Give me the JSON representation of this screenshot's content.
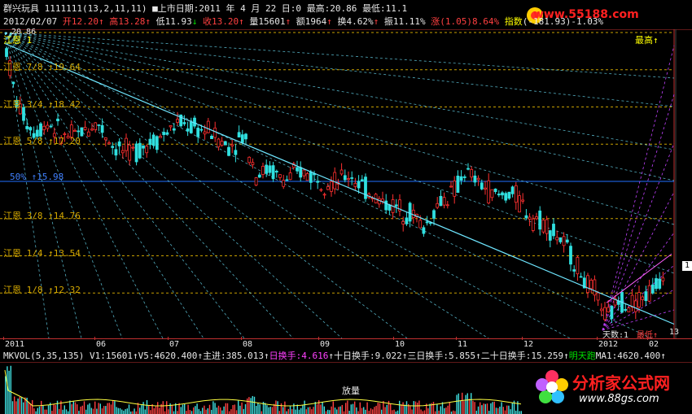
{
  "window": {
    "title": "群兴玩具",
    "code_params": "1111111(13,2,11,11)",
    "listing_label": "上市日期:2011 年 4 月 22 日:0",
    "high_label": "最高:20.86",
    "low_label": "最低:11.1"
  },
  "quote_line": {
    "date": "2012/02/07",
    "open": "开12.20",
    "high": "高13.28",
    "low": "低11.93",
    "close": "收13.20",
    "volume": "量15601",
    "amount": "额1964",
    "turnover": "换4.62%",
    "amplitude": "振11.11%",
    "change_label": "涨",
    "change": "(1.05)8.64%",
    "index_label": "指数",
    "index": "(-181.93)-1.03%"
  },
  "fan_levels": [
    {
      "label": "江恩 7/8",
      "value": "19.64"
    },
    {
      "label": "江恩 3/4",
      "value": "18.42"
    },
    {
      "label": "江恩 5/8",
      "value": "17.20"
    },
    {
      "label": "50%",
      "value": "15.98"
    },
    {
      "label": "江恩 3/8",
      "value": "14.76"
    },
    {
      "label": "江恩 1/4",
      "value": "13.54"
    },
    {
      "label": "江恩 1/8",
      "value": "12.32"
    }
  ],
  "chart_labels": {
    "top_left_value": "20.86",
    "top_left_tag": "江恩 1",
    "highest": "最高↑",
    "lowest": "最低↑",
    "days": "天数:1",
    "day_count": "13",
    "right_marker": "1"
  },
  "date_axis": [
    "2011",
    "06",
    "07",
    "08",
    "09",
    "10",
    "11",
    "12",
    "2012",
    "02"
  ],
  "volume_header": {
    "name": "MKVOL(5,35,135)",
    "v1": "V1:15601",
    "v5": "V5:4620.400",
    "main_in": "主进:385.013",
    "day_turnover_label": "日换手",
    "day_turnover": "4.616",
    "ten_day": "十日换手:9.022",
    "three_day": "三日换手:5.855",
    "twenty_day": "二十日换手:15.259",
    "tomorrow": "明天跑",
    "ma1": "MA1:4620.400"
  },
  "volume_label": "放量",
  "brand": {
    "title": "分析家公式网",
    "url": "www.88gs.com"
  },
  "watermark": "www.55188.com",
  "colors": {
    "background": "#000000",
    "fan_orange": "#c8a000",
    "fan_blue": "#2070ff",
    "trend": "#6ee6ff",
    "candle_up": "#ff3030",
    "candle_down": "#30e0e0",
    "projection": "#c040ff"
  },
  "chart_data": {
    "type": "candlestick",
    "ylim": [
      11.1,
      20.86
    ],
    "levels": [
      19.64,
      18.42,
      17.2,
      15.98,
      14.76,
      13.54,
      12.32
    ]
  }
}
